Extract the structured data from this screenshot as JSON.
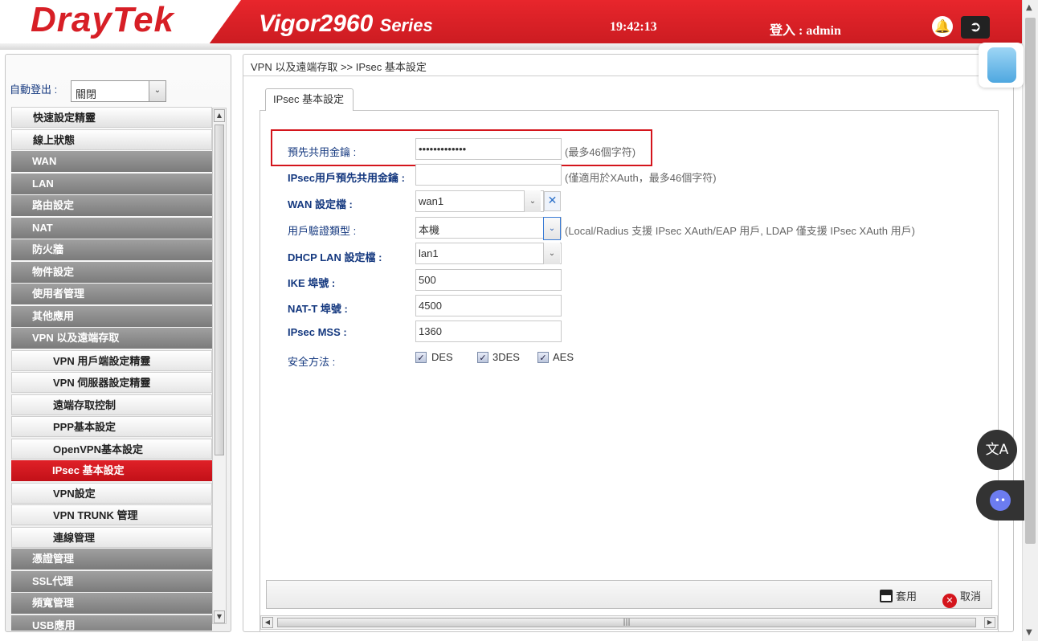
{
  "header": {
    "brand": "DrayTek",
    "model": "Vigor2960",
    "series": "Series",
    "time": "19:42:13",
    "login_label": "登入 : admin"
  },
  "sidebar": {
    "auto_logout_label": "自動登出 :",
    "auto_logout_value": "關閉",
    "items": [
      {
        "label": "快速設定精靈",
        "type": "top"
      },
      {
        "label": "線上狀態",
        "type": "top"
      },
      {
        "label": "WAN",
        "type": "main"
      },
      {
        "label": "LAN",
        "type": "main"
      },
      {
        "label": "路由設定",
        "type": "main"
      },
      {
        "label": "NAT",
        "type": "main"
      },
      {
        "label": "防火牆",
        "type": "main"
      },
      {
        "label": "物件設定",
        "type": "main"
      },
      {
        "label": "使用者管理",
        "type": "main"
      },
      {
        "label": "其他應用",
        "type": "main"
      },
      {
        "label": "VPN 以及遠端存取",
        "type": "main"
      },
      {
        "label": "VPN 用戶端設定精靈",
        "type": "sub"
      },
      {
        "label": "VPN 伺服器設定精靈",
        "type": "sub"
      },
      {
        "label": "遠端存取控制",
        "type": "sub"
      },
      {
        "label": "PPP基本設定",
        "type": "sub"
      },
      {
        "label": "OpenVPN基本設定",
        "type": "sub"
      },
      {
        "label": "IPsec 基本設定",
        "type": "active"
      },
      {
        "label": "VPN設定",
        "type": "sub"
      },
      {
        "label": "VPN TRUNK 管理",
        "type": "sub"
      },
      {
        "label": "連線管理",
        "type": "sub"
      },
      {
        "label": "憑證管理",
        "type": "main"
      },
      {
        "label": "SSL代理",
        "type": "main"
      },
      {
        "label": "頻寬管理",
        "type": "main"
      },
      {
        "label": "USB應用",
        "type": "main"
      }
    ]
  },
  "main": {
    "breadcrumb": "VPN 以及遠端存取 >> IPsec 基本設定",
    "tab_label": "IPsec 基本設定",
    "form": {
      "psk_label": "預先共用金鑰 :",
      "psk_value": "•••••••••••••",
      "psk_note": "(最多46個字符)",
      "user_psk_label": "IPsec用戶預先共用金鑰 :",
      "user_psk_value": "",
      "user_psk_note": "(僅適用於XAuth，最多46個字符)",
      "wan_profile_label": "WAN 設定檔 :",
      "wan_profile_value": "wan1",
      "auth_type_label": "用戶驗證類型 :",
      "auth_type_value": "本機",
      "auth_type_note": "(Local/Radius 支援 IPsec XAuth/EAP 用戶, LDAP 僅支援 IPsec XAuth 用戶)",
      "dhcp_lan_label": "DHCP LAN 設定檔 :",
      "dhcp_lan_value": "lan1",
      "ike_port_label": "IKE 埠號 :",
      "ike_port_value": "500",
      "natt_port_label": "NAT-T 埠號 :",
      "natt_port_value": "4500",
      "mss_label": "IPsec MSS :",
      "mss_value": "1360",
      "security_label": "安全方法 :",
      "methods": [
        {
          "label": "DES",
          "checked": true
        },
        {
          "label": "3DES",
          "checked": true
        },
        {
          "label": "AES",
          "checked": true
        }
      ]
    },
    "footer": {
      "apply_label": "套用",
      "cancel_label": "取消"
    }
  },
  "colors": {
    "brand_red": "#d71f26",
    "label_blue": "#14387f",
    "menu_gray": "#8e8e8e",
    "highlight": "#d4151c"
  }
}
